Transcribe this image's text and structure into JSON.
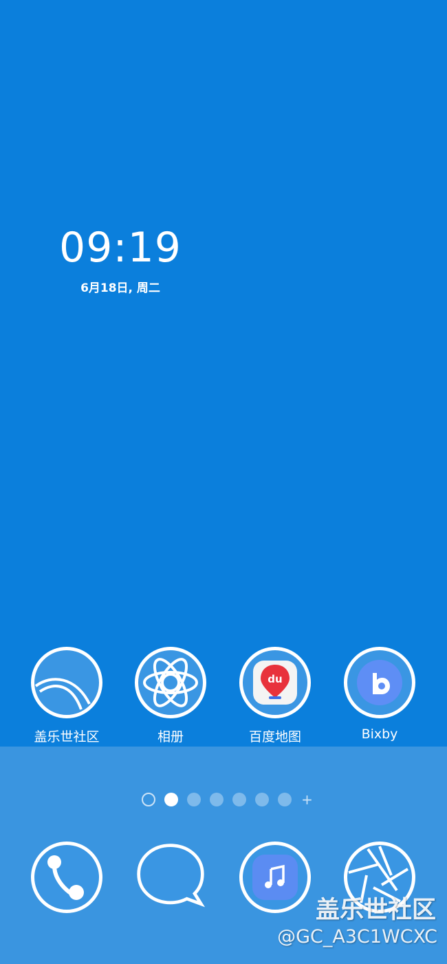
{
  "clock": {
    "time": "09:19",
    "date": "6月18日, 周二"
  },
  "home_apps": [
    {
      "label": "盖乐世社区",
      "icon": "community-icon"
    },
    {
      "label": "相册",
      "icon": "gallery-icon"
    },
    {
      "label": "百度地图",
      "icon": "baidu-maps-icon",
      "badge_text": "du"
    },
    {
      "label": "Bixby",
      "icon": "bixby-icon"
    }
  ],
  "page_indicator": {
    "count": 7,
    "active_index": 1,
    "add_symbol": "+"
  },
  "dock_apps": [
    {
      "icon": "phone-icon"
    },
    {
      "icon": "messages-icon"
    },
    {
      "icon": "music-icon"
    },
    {
      "icon": "camera-icon"
    }
  ],
  "watermark": {
    "line1": "盖乐世社区",
    "line2": "@GC_A3C1WCXC"
  },
  "colors": {
    "wallpaper": "#0b7fdc",
    "dock": "#3a95e0",
    "icon_fill": "#3a96e3",
    "maps_red": "#e8323c",
    "bixby_blue": "#5e8ef5"
  }
}
